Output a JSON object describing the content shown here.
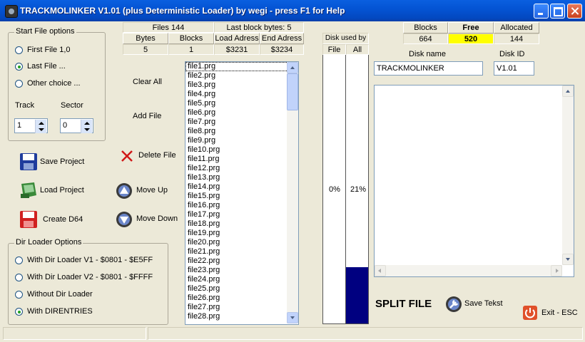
{
  "window": {
    "title": "TRACKMOLINKER V1.01 (plus Deterministic Loader) by wegi - press F1 for Help"
  },
  "start_file_options": {
    "legend": "Start File options",
    "options": [
      {
        "label": "First File 1,0",
        "selected": false
      },
      {
        "label": "Last File ...",
        "selected": true
      },
      {
        "label": "Other choice ...",
        "selected": false
      }
    ],
    "track_label": "Track",
    "sector_label": "Sector",
    "track_value": "1",
    "sector_value": "0"
  },
  "actions": {
    "save_project": "Save Project",
    "load_project": "Load Project",
    "create_d64": "Create D64",
    "clear_all": "Clear All",
    "add_file": "Add File",
    "delete_file": "Delete File",
    "move_up": "Move   Up",
    "move_down": "Move Down"
  },
  "dir_loader_options": {
    "legend": "Dir Loader Options",
    "options": [
      {
        "label": "With Dir Loader V1 - $0801 - $E5FF",
        "selected": false
      },
      {
        "label": "With Dir Loader V2 - $0801 - $FFFF",
        "selected": false
      },
      {
        "label": "Without Dir Loader",
        "selected": false
      },
      {
        "label": "With DIRENTRIES",
        "selected": true
      }
    ]
  },
  "file_info": {
    "files_label": "Files 144",
    "last_block_label": "Last block bytes: 5",
    "headers": [
      "Bytes",
      "Blocks",
      "Load Adress",
      "End Adress"
    ],
    "values": [
      "5",
      "1",
      "$3231",
      "$3234"
    ]
  },
  "file_list": {
    "items": [
      "file1.prg",
      "file2.prg",
      "file3.prg",
      "file4.prg",
      "file5.prg",
      "file6.prg",
      "file7.prg",
      "file8.prg",
      "file9.prg",
      "file10.prg",
      "file11.prg",
      "file12.prg",
      "file13.prg",
      "file14.prg",
      "file15.prg",
      "file16.prg",
      "file17.prg",
      "file18.prg",
      "file19.prg",
      "file20.prg",
      "file21.prg",
      "file22.prg",
      "file23.prg",
      "file24.prg",
      "file25.prg",
      "file26.prg",
      "file27.prg",
      "file28.prg"
    ],
    "selected_index": 0
  },
  "disk_used": {
    "header": "Disk used by",
    "file_label": "File",
    "all_label": "All",
    "file_percent": "0%",
    "all_percent": "21%",
    "file_fraction": 0.0,
    "all_fraction": 0.21,
    "fill_color": "#000080"
  },
  "block_stats": {
    "headers": [
      "Blocks",
      "Free",
      "Allocated"
    ],
    "values": [
      "664",
      "520",
      "144"
    ],
    "free_highlight_color": "#ffff00"
  },
  "disk": {
    "name_label": "Disk name",
    "id_label": "Disk ID",
    "name_value": "TRACKMOLINKER",
    "id_value": "V1.01"
  },
  "bottom_right": {
    "split_file": "SPLIT FILE",
    "save_text": "Save Tekst",
    "exit": "Exit - ESC"
  }
}
